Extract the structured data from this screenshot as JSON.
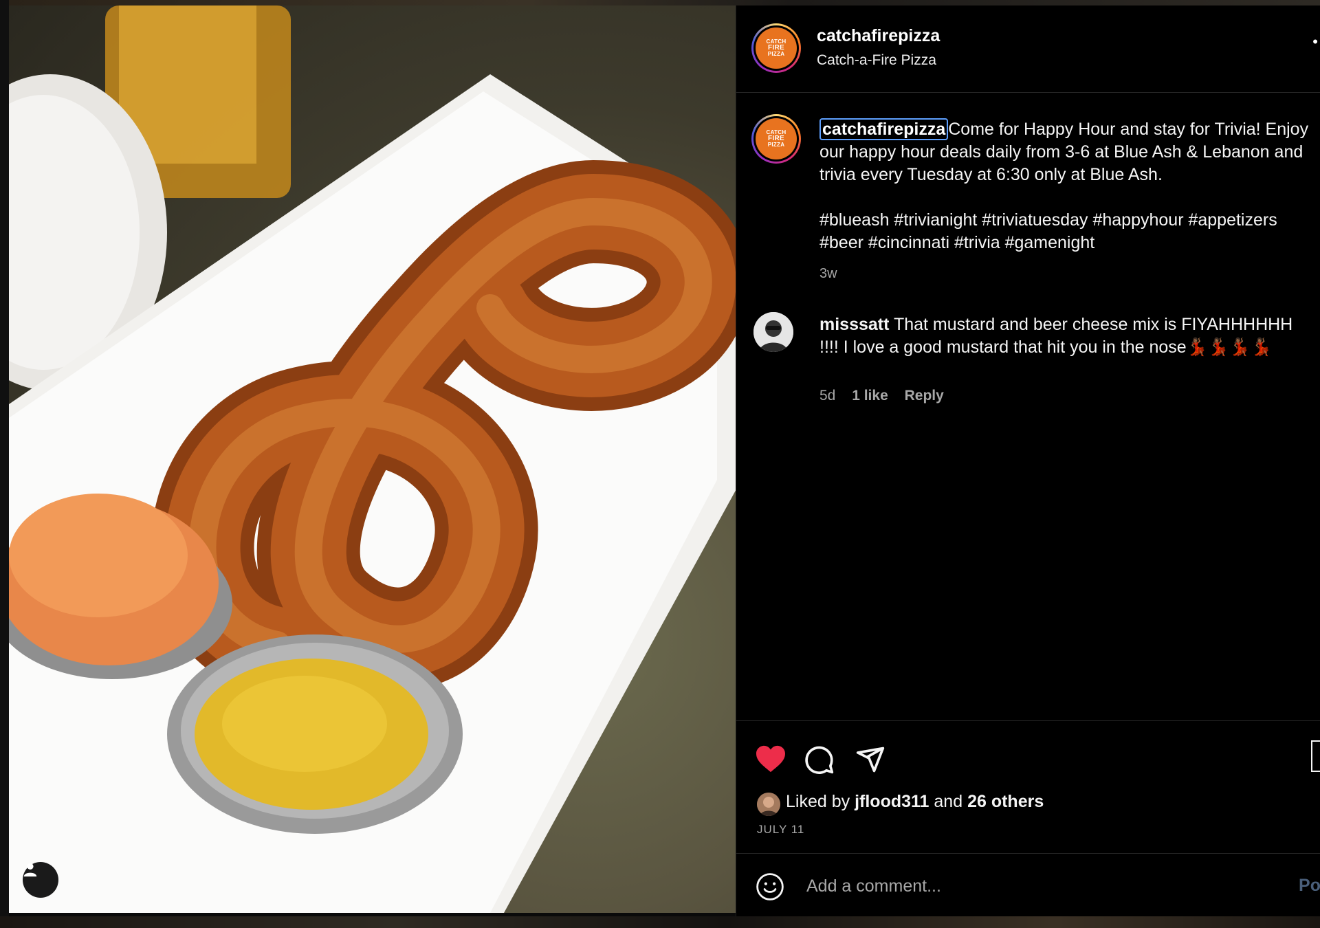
{
  "post": {
    "username": "catchafirepizza",
    "full_name": "Catch-a-Fire Pizza",
    "avatar_text": [
      "CATCH",
      "FIRE",
      "PIZZA"
    ],
    "caption_username": "catchafirepizza",
    "caption_line1": "Come for Happy Hour and stay for Trivia! Enjoy our happy hour deals daily from 3-6 at Blue Ash & Lebanon and trivia every Tuesday at 6:30 only at Blue Ash.",
    "hashtags": "#blueash #trivianight #triviatuesday #happyhour #appetizers #beer #cincinnati #trivia #gamenight",
    "age": "3w"
  },
  "comments": [
    {
      "username": "misssatt",
      "text": "That mustard and beer cheese mix is FIYAHHHHHH !!!! I love a good mustard that hit you in the nose💃🏾💃🏾💃🏾💃🏾",
      "age": "5d",
      "likes": "1 like",
      "reply_label": "Reply"
    }
  ],
  "actions": {
    "liked": true,
    "liked_by_prefix": "Liked by",
    "liked_by_user": "jflood311",
    "liked_by_and": "and",
    "liked_by_others": "26 others",
    "date": "JULY 11"
  },
  "comment_box": {
    "placeholder": "Add a comment...",
    "post_label": "Po"
  },
  "colors": {
    "heart": "#ed2d4a",
    "link_focus": "#5ea0ff",
    "brand_orange": "#e8731f"
  }
}
